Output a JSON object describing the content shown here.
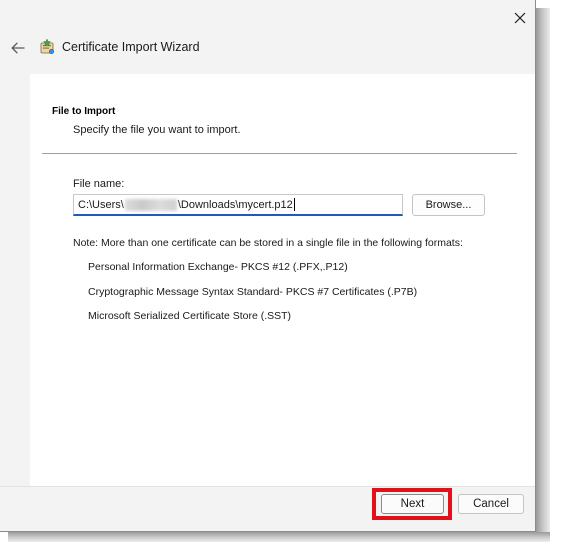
{
  "window": {
    "title": "Certificate Import Wizard",
    "close_icon": "close-icon",
    "back_icon": "back-arrow-icon",
    "wizard_icon": "certificate-wizard-icon"
  },
  "section": {
    "title": "File to Import",
    "subtitle": "Specify the file you want to import."
  },
  "file_field": {
    "label": "File name:",
    "value_prefix": "C:\\Users\\",
    "value_redacted": "[blurred username]",
    "value_suffix": "\\Downloads\\mycert.p12"
  },
  "browse_label": "Browse...",
  "note": "Note:  More than one certificate can be stored in a single file in the following formats:",
  "formats": [
    "Personal Information Exchange- PKCS #12 (.PFX,.P12)",
    "Cryptographic Message Syntax Standard- PKCS #7 Certificates (.P7B)",
    "Microsoft Serialized Certificate Store (.SST)"
  ],
  "footer": {
    "next_label": "Next",
    "cancel_label": "Cancel",
    "highlight_color": "#e3101b"
  },
  "colors": {
    "accent": "#1a5fb4",
    "dialog_bg": "#f3f3f3"
  }
}
